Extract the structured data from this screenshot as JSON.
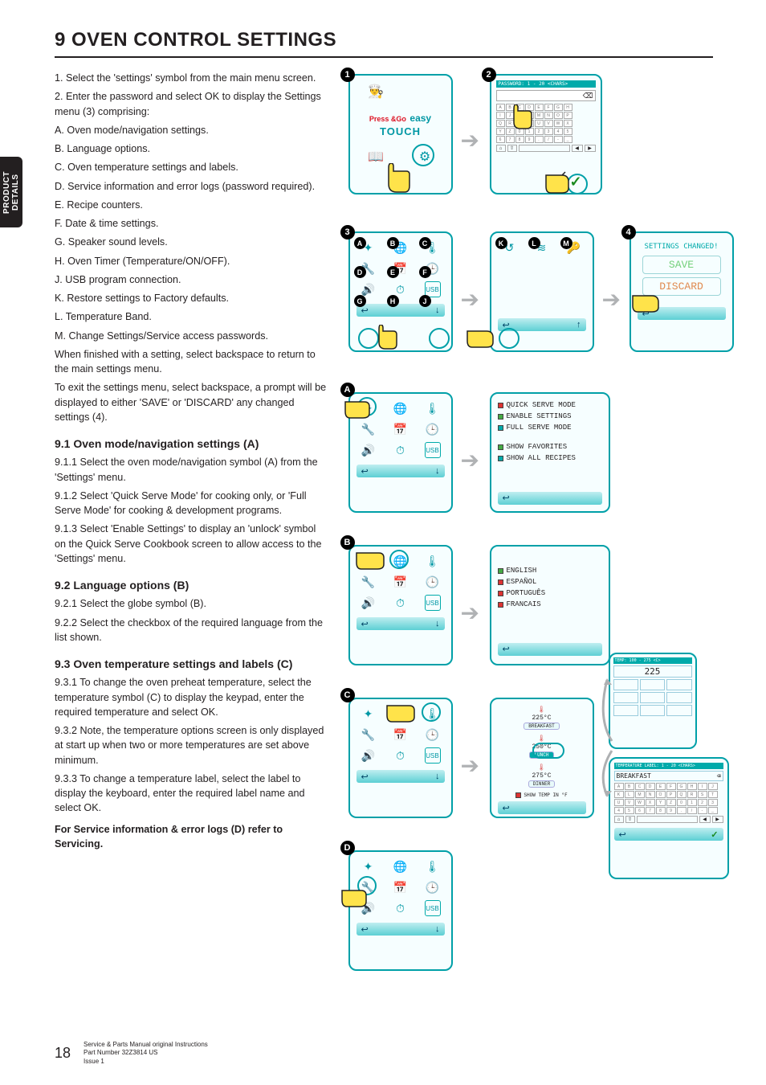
{
  "side_tab": {
    "line1": "PRODUCT",
    "line2": "DETAILS"
  },
  "heading": "9  OVEN CONTROL SETTINGS",
  "intro": [
    "1. Select the 'settings' symbol from the main menu screen.",
    "2. Enter the password and select OK to display the Settings menu (3) comprising:",
    "A. Oven mode/navigation settings.",
    "B. Language options.",
    "C. Oven temperature settings and labels.",
    "D. Service information and error logs (password required).",
    "E. Recipe counters.",
    "F. Date & time settings.",
    "G. Speaker sound levels.",
    "H. Oven Timer (Temperature/ON/OFF).",
    "J. USB program connection.",
    "K. Restore settings to Factory defaults.",
    "L. Temperature Band.",
    "M. Change Settings/Service access passwords.",
    "When finished with a setting, select backspace to return to the main settings menu.",
    "To exit the settings menu, select backspace, a prompt will be displayed to either 'SAVE' or 'DISCARD' any changed settings (4)."
  ],
  "s91": {
    "h": "9.1  Oven mode/navigation settings (A)",
    "p": [
      "9.1.1  Select the oven mode/navigation symbol (A) from the 'Settings' menu.",
      "9.1.2  Select 'Quick Serve Mode' for cooking only, or 'Full Serve Mode' for cooking & development programs.",
      "9.1.3  Select 'Enable Settings' to display an 'unlock' symbol on the Quick Serve Cookbook screen to allow access to the 'Settings' menu."
    ]
  },
  "s92": {
    "h": "9.2  Language options (B)",
    "p": [
      "9.2.1  Select the globe symbol (B).",
      "9.2.2  Select the checkbox of the required language from the list shown."
    ]
  },
  "s93": {
    "h": "9.3  Oven temperature settings and labels (C)",
    "p": [
      "9.3.1  To change the oven preheat temperature, select the temperature symbol (C) to display the keypad, enter the required temperature and select OK.",
      "9.3.2  Note, the temperature options screen is only displayed at start up when two or more temperatures are set above minimum.",
      "9.3.3  To change a temperature label, select the label to display the keyboard, enter the required label name and select OK."
    ],
    "note": "For Service information & error logs (D) refer to Servicing."
  },
  "logo": {
    "press": "Press &Go",
    "easy": "easy",
    "touch": "TOUCH"
  },
  "pw_header": "PASSWORD: 1 - 20 <CHARS>",
  "callouts": {
    "n1": "1",
    "n2": "2",
    "n3": "3",
    "n4": "4",
    "A": "A",
    "B": "B",
    "C": "C",
    "D": "D",
    "E": "E",
    "F": "F",
    "G": "G",
    "H": "H",
    "J": "J",
    "K": "K",
    "L": "L",
    "M": "M"
  },
  "save_panel": {
    "title": "SETTINGS CHANGED!",
    "save": "SAVE",
    "discard": "DISCARD"
  },
  "menuA": [
    "QUICK SERVE MODE",
    "ENABLE SETTINGS",
    "FULL SERVE MODE",
    "SHOW FAVORITES",
    "SHOW ALL RECIPES"
  ],
  "menuB": [
    "ENGLISH",
    "ESPAÑOL",
    "PORTUGUÊS",
    "FRANCAIS"
  ],
  "tempC": {
    "t1": "225°C",
    "l1": "BREAKFAST",
    "t2": "250°C",
    "l2": "LUNCH",
    "t3": "275°C",
    "l3": "DINNER",
    "cb": "SHOW TEMP IN °F"
  },
  "keypad_header": "TEMP: 100 - 275 <C>",
  "keypad_value": "225",
  "kb2_header": "TEMPERATURE LABEL: 1 - 20 <CHARS>",
  "kb2_value": "BREAKFAST",
  "footer": {
    "page": "18",
    "l1": "Service & Parts Manual original Instructions",
    "l2": "Part Number 32Z3814 US",
    "l3": "Issue 1"
  },
  "glyph": {
    "chef": "👨‍🍳",
    "book": "📖",
    "gear": "⚙",
    "globe": "🌐",
    "therm": "🌡",
    "wrench": "🔧",
    "cal": "📅",
    "clock": "🕒",
    "speaker": "🔊",
    "timer": "⏱",
    "usb": "USB",
    "reset": "↺",
    "band": "≋",
    "key": "🔑",
    "back": "↩",
    "down": "↓",
    "up": "↑",
    "check": "✓",
    "home": "⌂",
    "shift": "⇧"
  }
}
